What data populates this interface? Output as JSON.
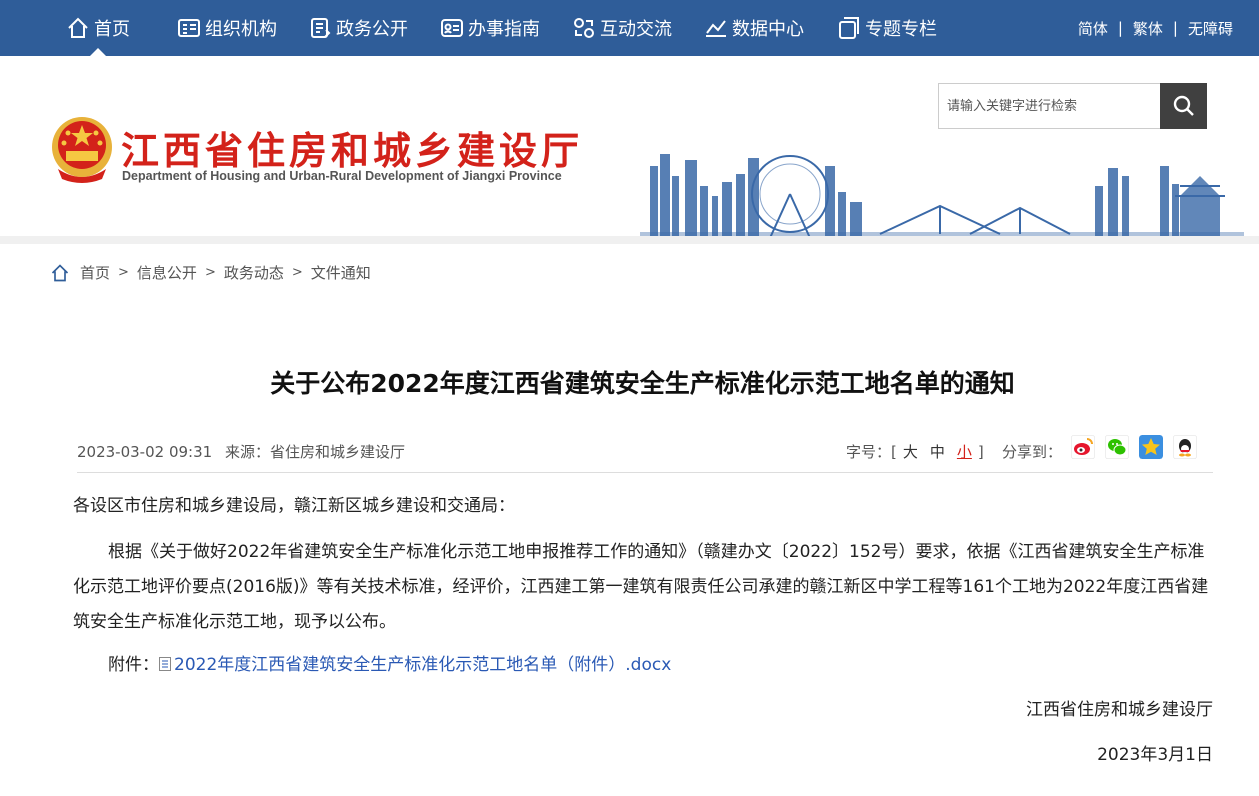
{
  "nav": {
    "items": [
      {
        "label": "首页",
        "icon": "home-icon"
      },
      {
        "label": "组织机构",
        "icon": "org-icon"
      },
      {
        "label": "政务公开",
        "icon": "document-icon"
      },
      {
        "label": "办事指南",
        "icon": "guide-icon"
      },
      {
        "label": "互动交流",
        "icon": "exchange-icon"
      },
      {
        "label": "数据中心",
        "icon": "chart-icon"
      },
      {
        "label": "专题专栏",
        "icon": "topic-icon"
      }
    ],
    "lang": {
      "simplified": "简体",
      "traditional": "繁体",
      "accessible": "无障碍",
      "sep": "|"
    }
  },
  "header": {
    "title": "江西省住房和城乡建设厅",
    "subtitle": "Department of Housing and Urban-Rural Development of Jiangxi Province",
    "search_placeholder": "请输入关键字进行检索"
  },
  "breadcrumb": [
    "首页",
    "信息公开",
    "政务动态",
    "文件通知"
  ],
  "breadcrumb_sep": ">",
  "article": {
    "title": "关于公布2022年度江西省建筑安全生产标准化示范工地名单的通知",
    "date": "2023-03-02 09:31",
    "source": "来源：省住房和城乡建设厅",
    "font_label": "字号：[",
    "font_large": "大",
    "font_medium": "中",
    "font_small": "小",
    "font_close": "]",
    "share_label": "分享到：",
    "salutation": "各设区市住房和城乡建设局，赣江新区城乡建设和交通局：",
    "paragraph": "根据《关于做好2022年省建筑安全生产标准化示范工地申报推荐工作的通知》（赣建办文〔2022〕152号）要求，依据《江西省建筑安全生产标准化示范工地评价要点(2016版)》等有关技术标准，经评价，江西建工第一建筑有限责任公司承建的赣江新区中学工程等161个工地为2022年度江西省建筑安全生产标准化示范工地，现予以公布。",
    "attachment_label": "附件：",
    "attachment_name": "2022年度江西省建筑安全生产标准化示范工地名单（附件）.docx",
    "signature": "江西省住房和城乡建设厅",
    "sign_date": "2023年3月1日"
  },
  "colors": {
    "nav_bg": "#2f5d99",
    "title_red": "#d3221a",
    "link_blue": "#2a59b4"
  }
}
